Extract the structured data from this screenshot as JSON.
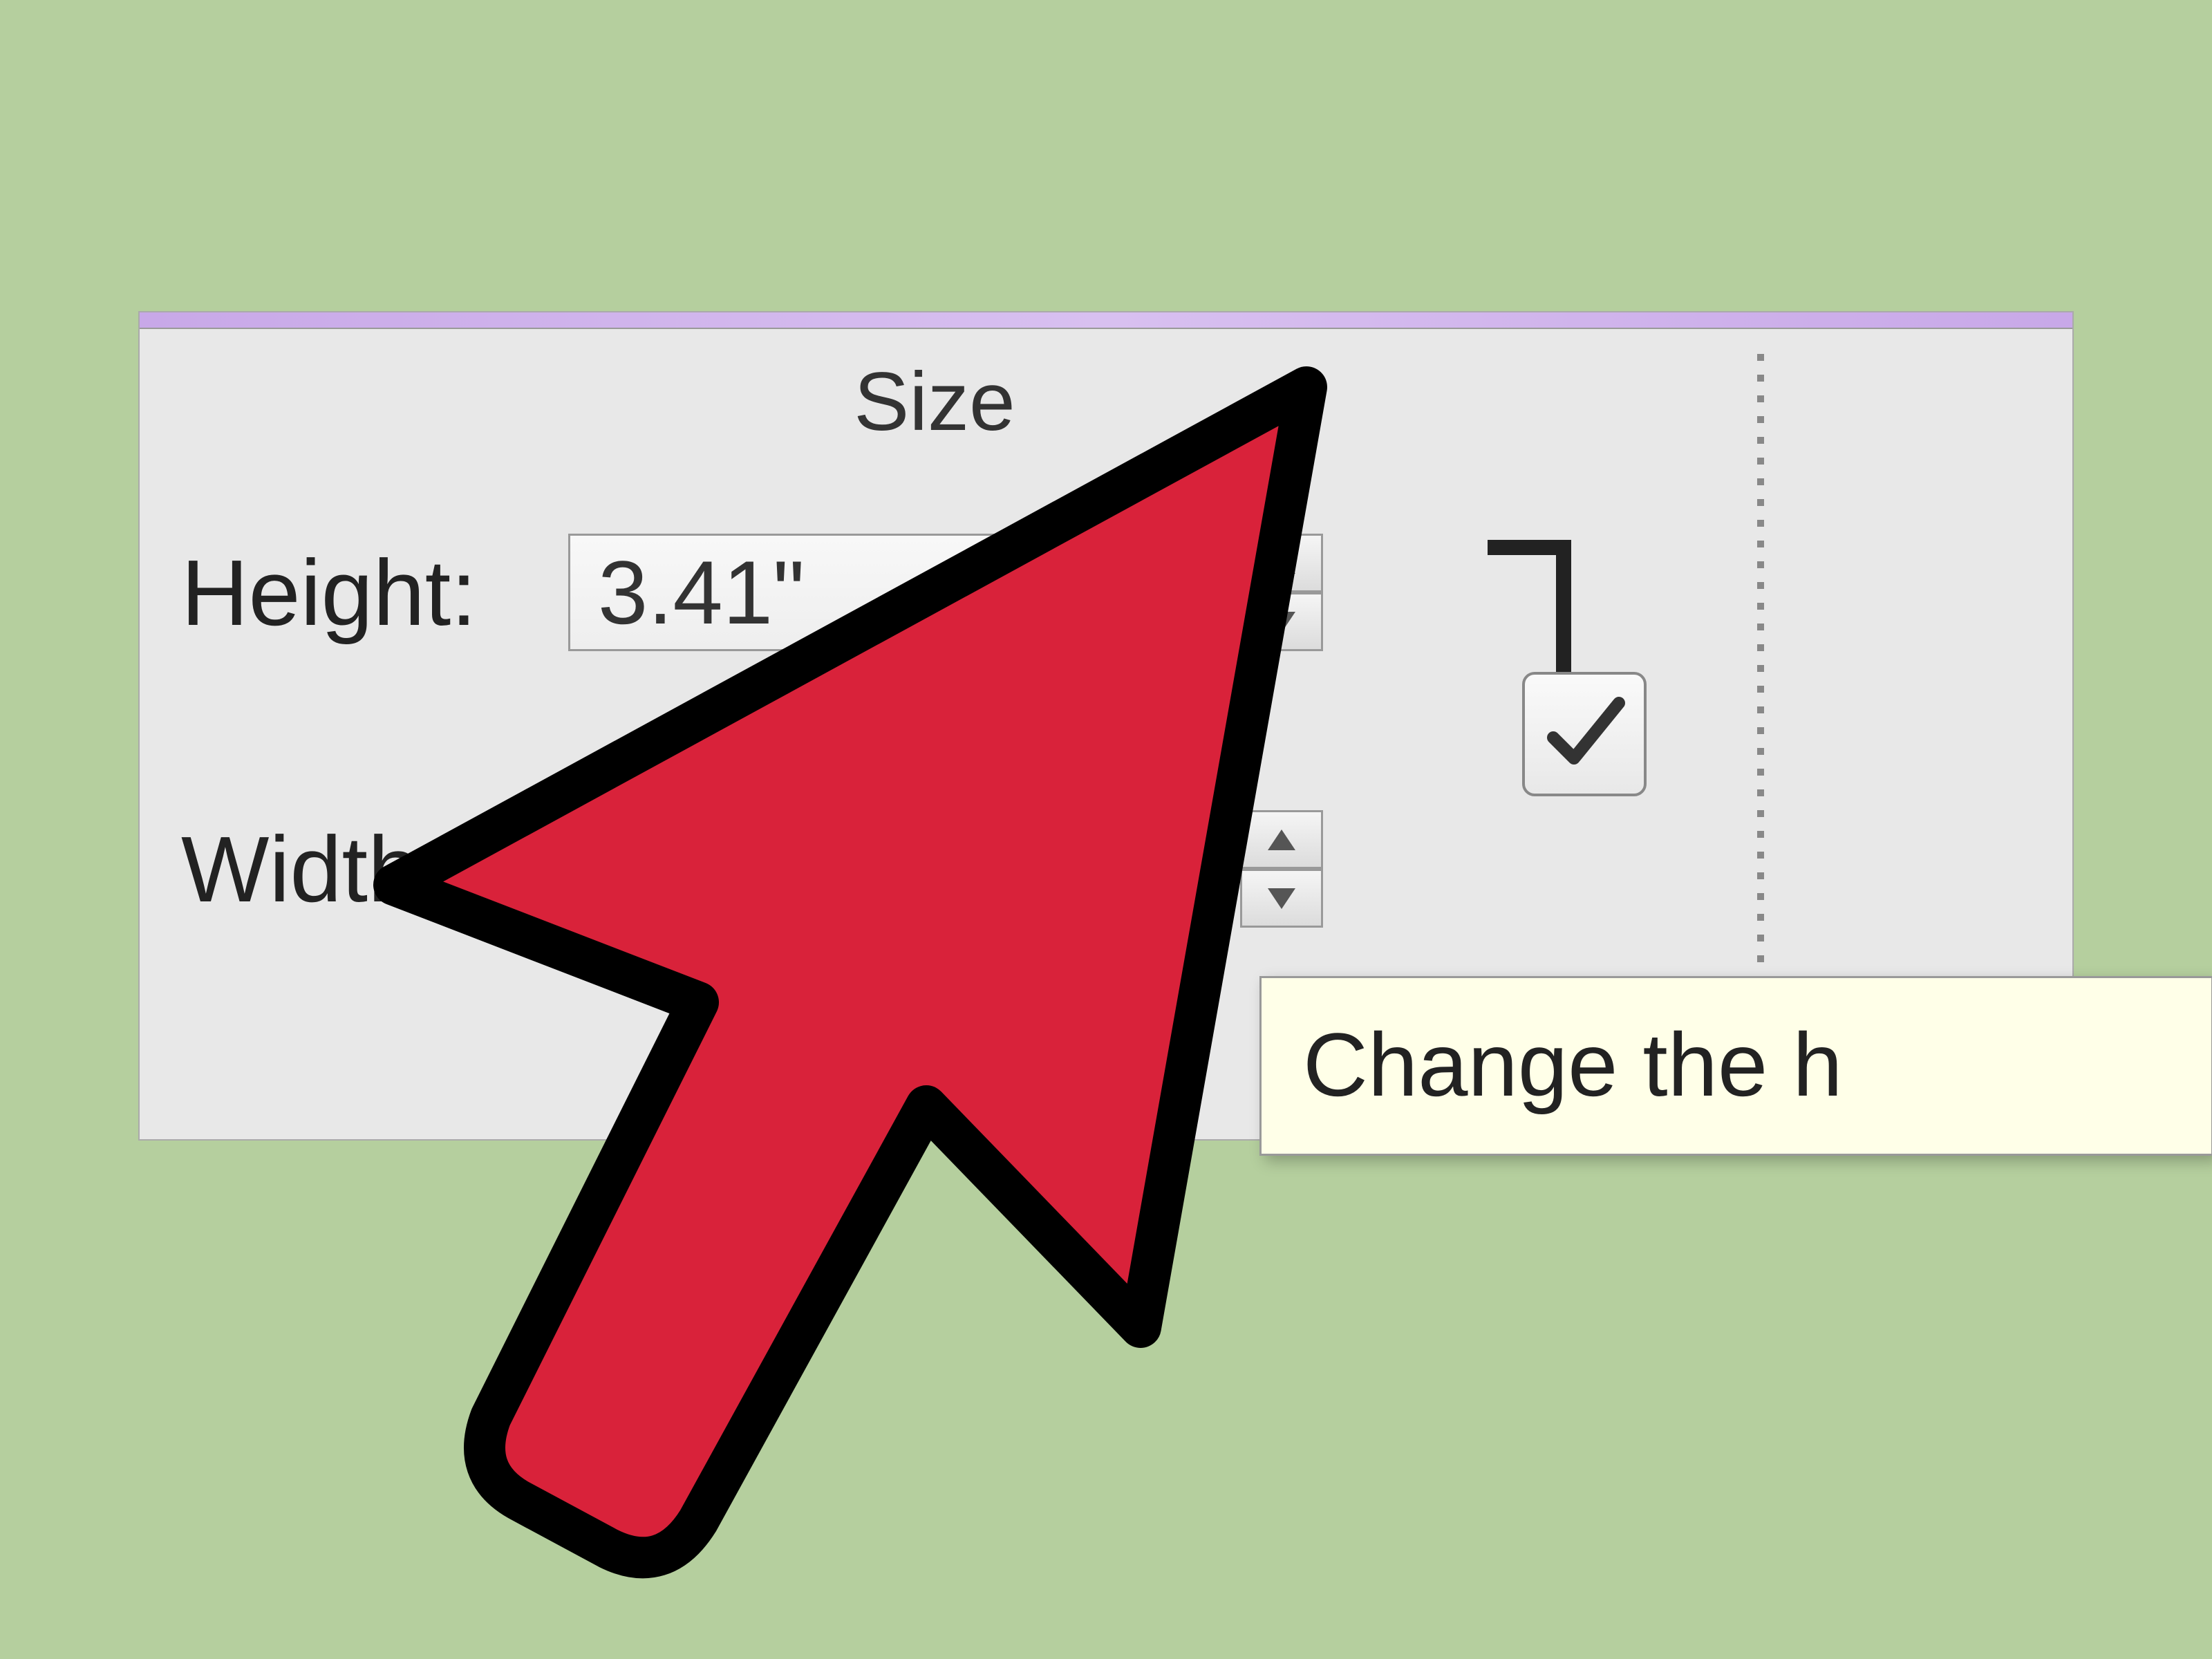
{
  "panel": {
    "title": "Size",
    "height": {
      "label": "Height:",
      "value": "3.41\""
    },
    "width": {
      "label": "Width:",
      "value": ""
    },
    "lockAspect": {
      "checked": true
    },
    "tooltip": "Change the h"
  },
  "colors": {
    "background": "#b5cf9e",
    "panelBg": "#e8e8e8",
    "accent": "#c8a8e8",
    "cursorFill": "#d9223a",
    "cursorStroke": "#000000"
  }
}
